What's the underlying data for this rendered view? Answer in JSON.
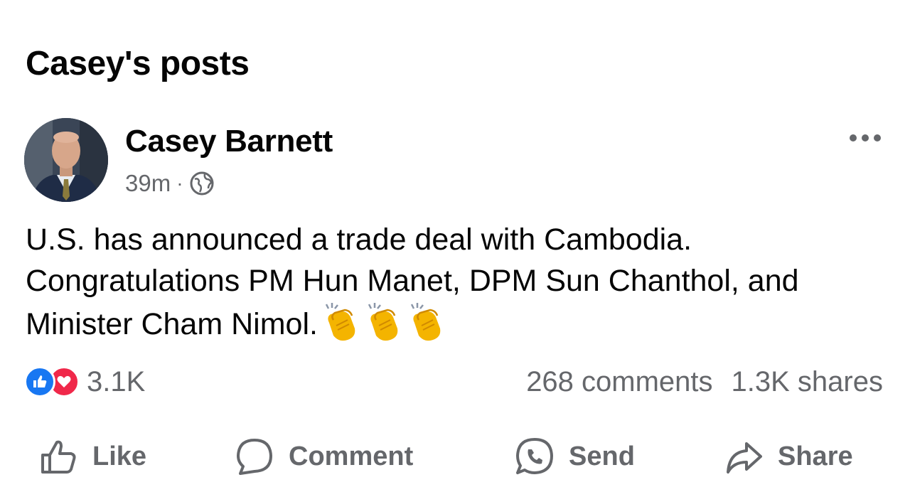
{
  "section": {
    "title": "Casey's posts"
  },
  "post": {
    "author": "Casey Barnett",
    "time": "39m",
    "separator": "·",
    "privacy_icon": "globe-icon",
    "text": "U.S. has announced a trade deal with Cambodia. Congratulations PM Hun Manet, DPM Sun Chanthol, and Minister Cham Nimol.",
    "emoji_icons": [
      "clapping-hands-icon",
      "clapping-hands-icon",
      "clapping-hands-icon"
    ],
    "reaction_icons": [
      "like-icon",
      "love-icon"
    ],
    "reaction_count": "3.1K",
    "comments": "268 comments",
    "shares": "1.3K shares"
  },
  "actions": {
    "like": "Like",
    "comment": "Comment",
    "send": "Send",
    "share": "Share"
  },
  "colors": {
    "text": "#050505",
    "muted": "#65676b",
    "like_blue": "#1877f2",
    "love_red": "#f0284a"
  }
}
